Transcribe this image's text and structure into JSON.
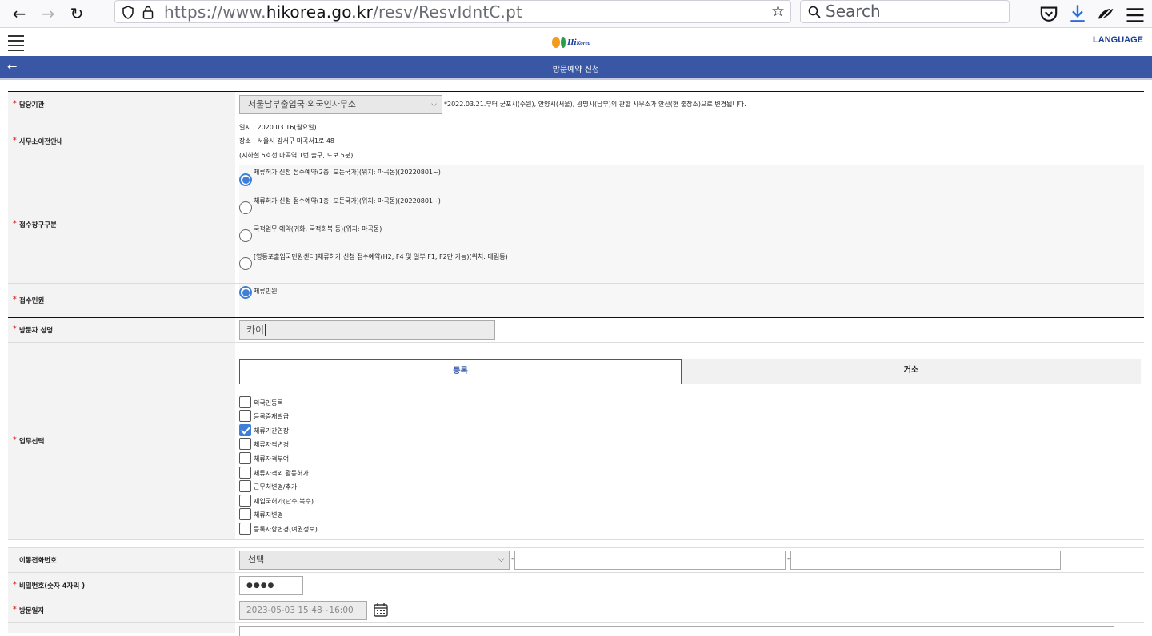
{
  "browser": {
    "back": "←",
    "forward": "→",
    "reload": "↻",
    "url_prefix": "https://www.",
    "url_domain": "hikorea.go.kr",
    "url_path": "/resv/ResvIdntC.pt",
    "search_placeholder": "Search",
    "icons": [
      "shield-icon",
      "lock-icon",
      "star-icon",
      "pocket-icon",
      "download-icon",
      "extension-icon",
      "menu-icon"
    ]
  },
  "header": {
    "logo_text": "Hi",
    "logo_sub": "Korea",
    "language": "LANGUAGE"
  },
  "title_bar": {
    "back": "←",
    "title": "방문예약 신청"
  },
  "form": {
    "agency": {
      "label": "담당기관",
      "selected": "서울남부출입국·외국인사무소",
      "note": "*2022.03.21.부터 군포시(수원), 안양시(서울), 광명시(남부)의 관할 사무소가 안산(현 출장소)으로 변경됩니다."
    },
    "relocation": {
      "label": "사무소이전안내",
      "lines": [
        "일시 : 2020.03.16(월요일)",
        "장소 : 서울시 강서구 마곡서1로 48",
        "(지하철 5호선 마곡역 1번 출구, 도보 5분)"
      ]
    },
    "window_type": {
      "label": "접수창구구분",
      "options": [
        "체류허가 신청 접수예약(2층, 모든국가)(위치: 마곡동)(20220801~)",
        "체류허가 신청 접수예약(1층, 모든국가)(위치: 마곡동)(20220801~)",
        "국적업무 예약(귀화, 국적회복 등)(위치: 마곡동)",
        "[영등포출입국민원센터]체류허가 신청 접수예약(H2, F4 및 일부 F1, F2만 가능)(위치: 대림동)"
      ],
      "selected_index": 0
    },
    "civil": {
      "label": "접수민원",
      "option": "체류민원"
    },
    "visitor_name": {
      "label": "방문자 성명",
      "value": "카이"
    },
    "task": {
      "label": "업무선택",
      "tabs": [
        "등록",
        "거소"
      ],
      "active_tab": 0,
      "items": [
        {
          "label": "외국인등록",
          "checked": false
        },
        {
          "label": "등록증재발급",
          "checked": false
        },
        {
          "label": "체류기간연장",
          "checked": true
        },
        {
          "label": "체류자격변경",
          "checked": false
        },
        {
          "label": "체류자격부여",
          "checked": false
        },
        {
          "label": "체류자격외 활동허가",
          "checked": false
        },
        {
          "label": "근무처변경/추가",
          "checked": false
        },
        {
          "label": "재입국허가(단수,복수)",
          "checked": false
        },
        {
          "label": "체류지변경",
          "checked": false
        },
        {
          "label": "등록사항변경(여권정보)",
          "checked": false
        }
      ]
    },
    "phone": {
      "label": "이동전화번호",
      "select": "선택",
      "dash": "-"
    },
    "password": {
      "label": "비밀번호(숫자 4자리 )",
      "value": "●●●●"
    },
    "visit_date": {
      "label": "방문일자",
      "value": "2023-05-03 15:48~16:00"
    },
    "required_mark": "*",
    "colors": {
      "accent": "#3a57a6",
      "required": "#e0322b",
      "check": "#3f7fd8"
    }
  }
}
